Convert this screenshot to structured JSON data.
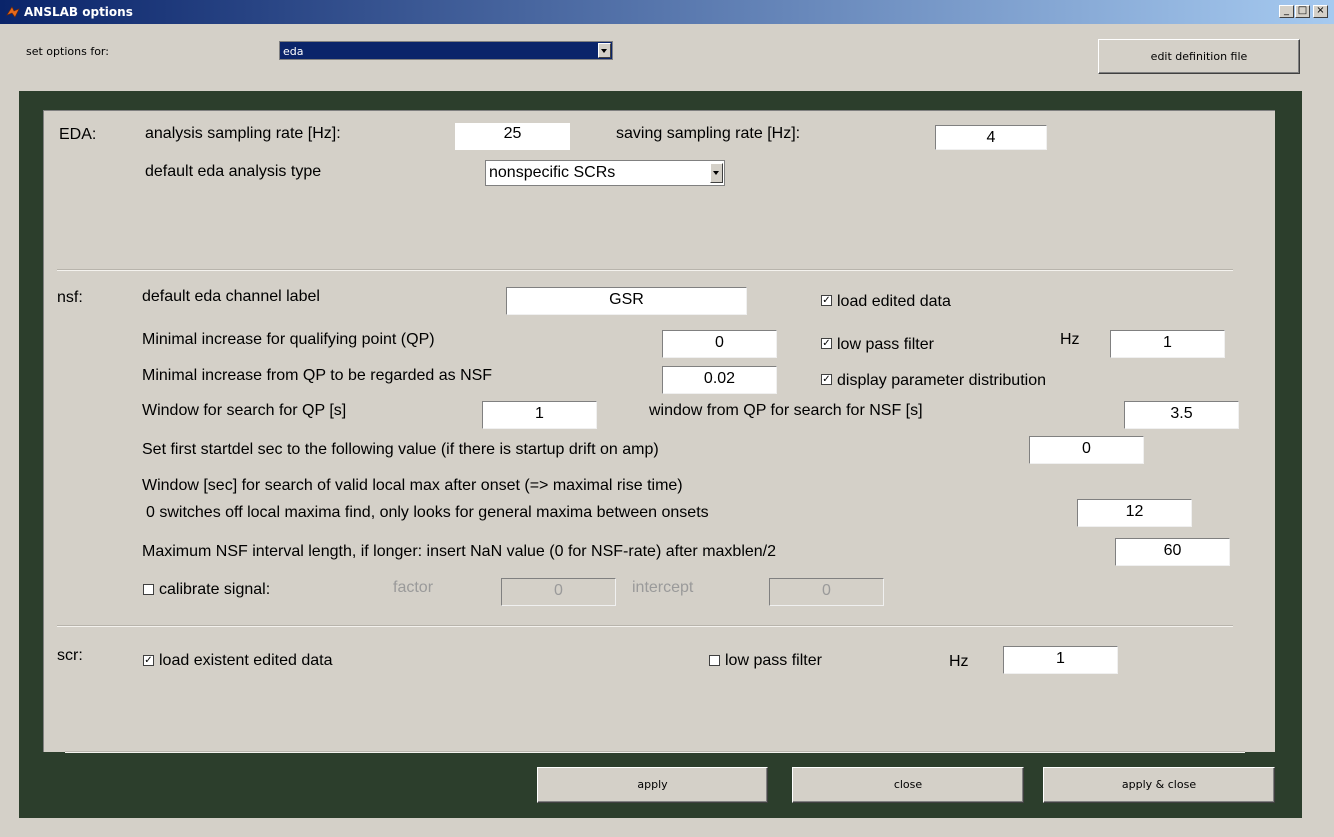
{
  "window": {
    "title": "ANSLAB options"
  },
  "header": {
    "set_options_label": "set options for:",
    "set_options_value": "eda",
    "edit_definition_label": "edit definition file"
  },
  "eda": {
    "section_label": "EDA:",
    "analysis_rate_label": "analysis sampling rate [Hz]:",
    "analysis_rate_value": "25",
    "saving_rate_label": "saving sampling rate [Hz]:",
    "saving_rate_value": "4",
    "analysis_type_label": "default eda analysis type",
    "analysis_type_value": "nonspecific SCRs"
  },
  "nsf": {
    "section_label": "nsf:",
    "channel_label_label": "default eda channel label",
    "channel_label_value": "GSR",
    "load_edited_label": "load edited data",
    "load_edited_checked": true,
    "qp_min_label": "Minimal increase for qualifying point (QP)",
    "qp_min_value": "0",
    "low_pass_label": "low pass filter",
    "low_pass_checked": true,
    "hz_label": "Hz",
    "hz_value": "1",
    "nsf_min_label": "Minimal increase from QP to be regarded as NSF",
    "nsf_min_value": "0.02",
    "display_dist_label": "display parameter distribution",
    "display_dist_checked": true,
    "qp_window_label": "Window for search for QP [s]",
    "qp_window_value": "1",
    "nsf_window_label": "window from QP for search for NSF [s]",
    "nsf_window_value": "3.5",
    "startdel_label": "Set first startdel sec to the following value (if there is startup drift on amp)",
    "startdel_value": "0",
    "local_max_label_1": "Window [sec] for search of valid local max after onset (=> maximal rise time)",
    "local_max_label_2": "0 switches off local maxima find, only looks for general maxima between onsets",
    "local_max_value": "12",
    "max_interval_label": "Maximum NSF interval length, if longer: insert NaN value (0 for NSF-rate) after maxblen/2",
    "max_interval_value": "60",
    "calibrate_label": "calibrate signal:",
    "calibrate_checked": false,
    "factor_label": "factor",
    "factor_value": "0",
    "intercept_label": "intercept",
    "intercept_value": "0"
  },
  "scr": {
    "section_label": "scr:",
    "load_existent_label": "load existent edited data",
    "load_existent_checked": true,
    "low_pass_label": "low pass filter",
    "low_pass_checked": false,
    "hz_label": "Hz",
    "hz_value": "1"
  },
  "footer": {
    "apply_label": "apply",
    "close_label": "close",
    "apply_close_label": "apply & close"
  },
  "glyphs": {
    "minimize": "_",
    "maximize": "□",
    "close": "×",
    "check": "✓"
  },
  "colors": {
    "title_start": "#0a246a",
    "title_end": "#a6caf0",
    "dark_frame": "#2c3e2c",
    "panel": "#d4d0c8"
  }
}
